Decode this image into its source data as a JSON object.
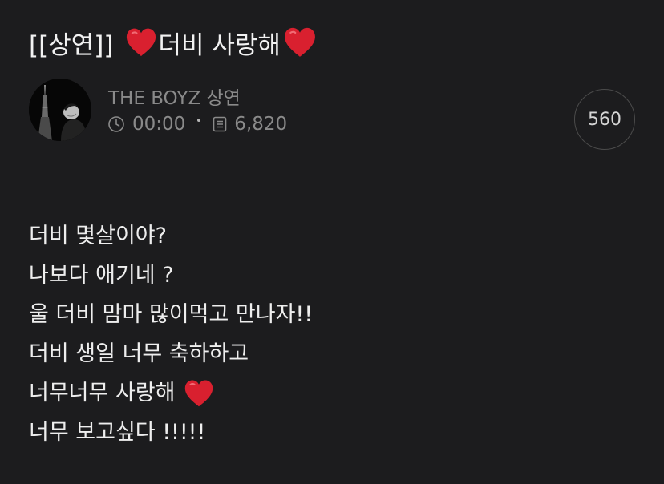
{
  "post": {
    "title_prefix": "[[상연]]",
    "title_text": "더비 사랑해",
    "heart_icon": "red-heart-emoji",
    "heart_color": "#d9202f"
  },
  "channel": {
    "name": "THE BOYZ 상연",
    "avatar_icon": "profile-photo"
  },
  "meta": {
    "time_icon": "clock-icon",
    "time": "00:00",
    "views_icon": "document-icon",
    "views": "6,820"
  },
  "likes": {
    "count": "560"
  },
  "body": {
    "lines": [
      "더비 몇살이야?",
      "나보다 애기네 ?",
      "울 더비 맘마 많이먹고 만나자!!",
      "더비 생일 너무 축하하고",
      "너무너무 사랑해",
      "너무 보고싶다 !!!!!"
    ]
  },
  "colors": {
    "background": "#1c1c1e",
    "muted_text": "#8a8a8a",
    "divider": "#3a3a3a"
  }
}
